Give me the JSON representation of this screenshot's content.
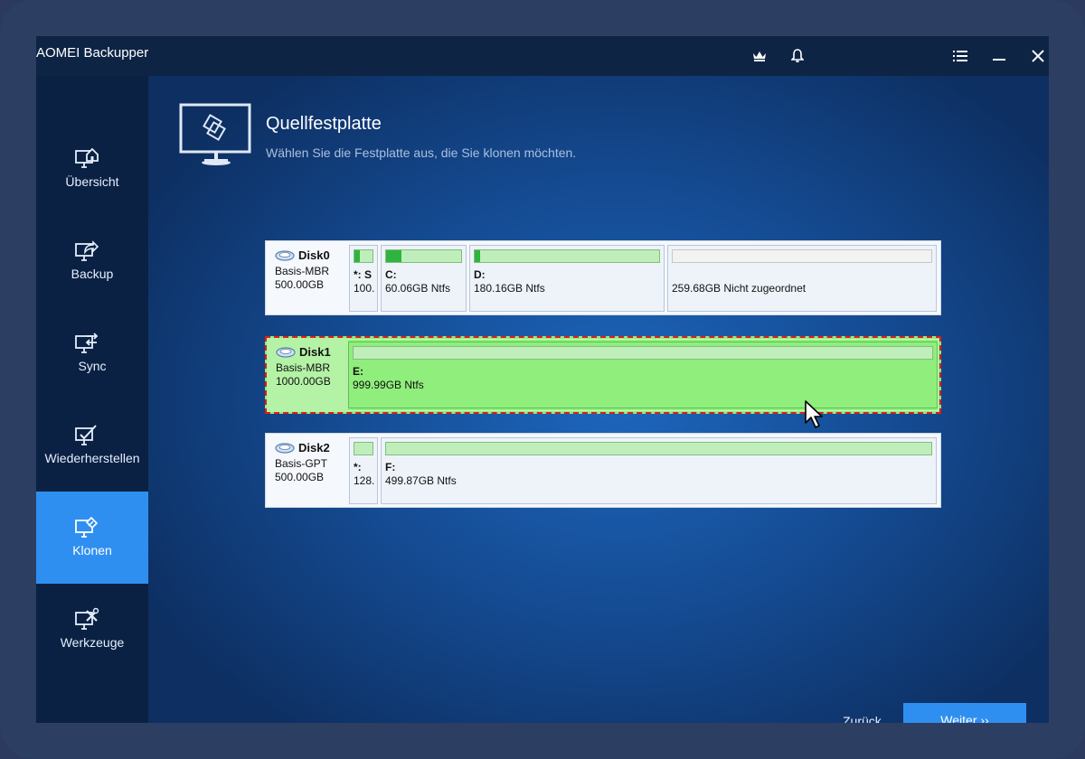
{
  "window": {
    "title": "AOMEI Backupper"
  },
  "sidebar": {
    "items": [
      {
        "label": "Übersicht",
        "icon": "home-monitor-icon",
        "active": false
      },
      {
        "label": "Backup",
        "icon": "backup-icon",
        "active": false
      },
      {
        "label": "Sync",
        "icon": "sync-icon",
        "active": false
      },
      {
        "label": "Wiederherstellen",
        "icon": "restore-icon",
        "active": false
      },
      {
        "label": "Klonen",
        "icon": "clone-icon",
        "active": true
      },
      {
        "label": "Werkzeuge",
        "icon": "tools-icon",
        "active": false
      }
    ]
  },
  "header": {
    "title": "Quellfestplatte",
    "subtitle": "Wählen Sie die Festplatte aus, die Sie klonen möchten."
  },
  "disks": [
    {
      "name": "Disk0",
      "type": "Basis-MBR",
      "size": "500.00GB",
      "selected": false,
      "partitions": [
        {
          "label": "*: S",
          "size": "100.",
          "used_fraction": 0.3
        },
        {
          "label": "C:",
          "size": "60.06GB Ntfs",
          "used_fraction": 0.2
        },
        {
          "label": "D:",
          "size": "180.16GB Ntfs",
          "used_fraction": 0.03
        },
        {
          "label": "",
          "size": "259.68GB Nicht zugeordnet",
          "used_fraction": 0
        }
      ]
    },
    {
      "name": "Disk1",
      "type": "Basis-MBR",
      "size": "1000.00GB",
      "selected": true,
      "partitions": [
        {
          "label": "E:",
          "size": "999.99GB Ntfs",
          "used_fraction": 0
        }
      ]
    },
    {
      "name": "Disk2",
      "type": "Basis-GPT",
      "size": "500.00GB",
      "selected": false,
      "partitions": [
        {
          "label": "*:",
          "size": "128.",
          "used_fraction": 0
        },
        {
          "label": "F:",
          "size": "499.87GB Ntfs",
          "used_fraction": 0
        }
      ]
    }
  ],
  "footer": {
    "back_label": "Zurück",
    "next_label": "Weiter ››"
  },
  "colors": {
    "accent": "#2f8ff0",
    "selected_disk": "#90ee7c",
    "selection_border": "#e01b1b",
    "used_space": "#2fb440"
  }
}
